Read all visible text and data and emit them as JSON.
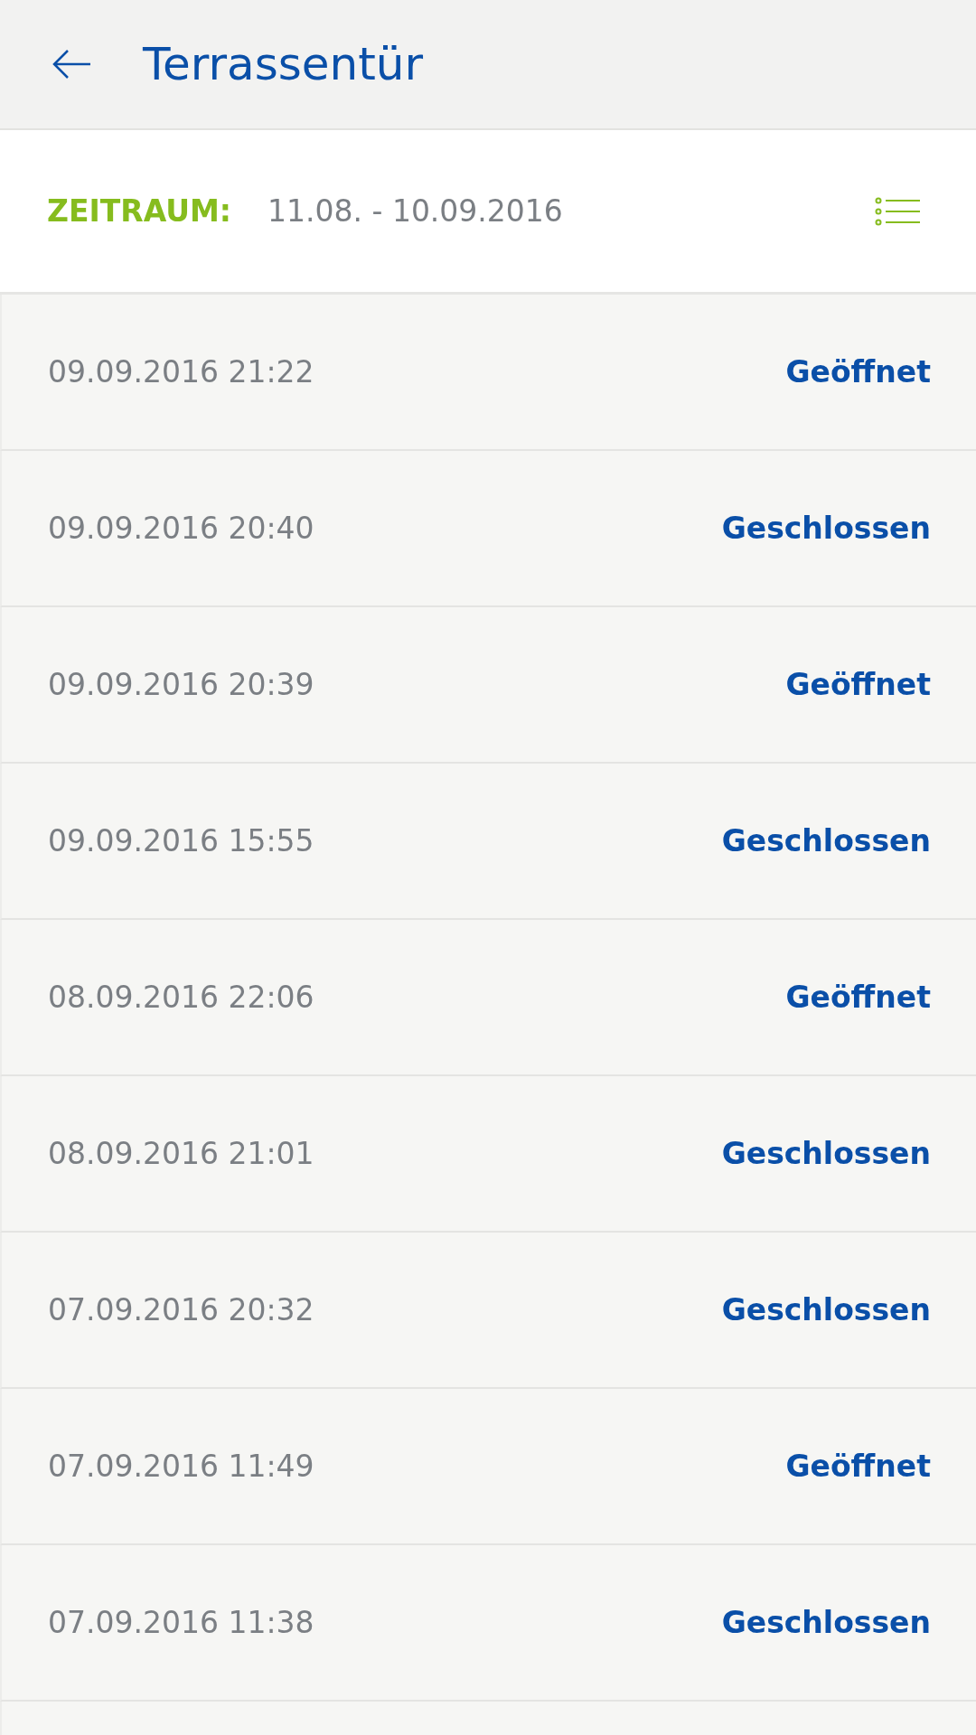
{
  "header": {
    "title": "Terrassentür"
  },
  "filter": {
    "label": "ZEITRAUM:",
    "value": "11.08. - 10.09.2016"
  },
  "events": [
    {
      "time": "09.09.2016 21:22",
      "status": "Geöffnet"
    },
    {
      "time": "09.09.2016 20:40",
      "status": "Geschlossen"
    },
    {
      "time": "09.09.2016 20:39",
      "status": "Geöffnet"
    },
    {
      "time": "09.09.2016 15:55",
      "status": "Geschlossen"
    },
    {
      "time": "08.09.2016 22:06",
      "status": "Geöffnet"
    },
    {
      "time": "08.09.2016 21:01",
      "status": "Geschlossen"
    },
    {
      "time": "07.09.2016 20:32",
      "status": "Geschlossen"
    },
    {
      "time": "07.09.2016 11:49",
      "status": "Geöffnet"
    },
    {
      "time": "07.09.2016 11:38",
      "status": "Geschlossen"
    }
  ]
}
